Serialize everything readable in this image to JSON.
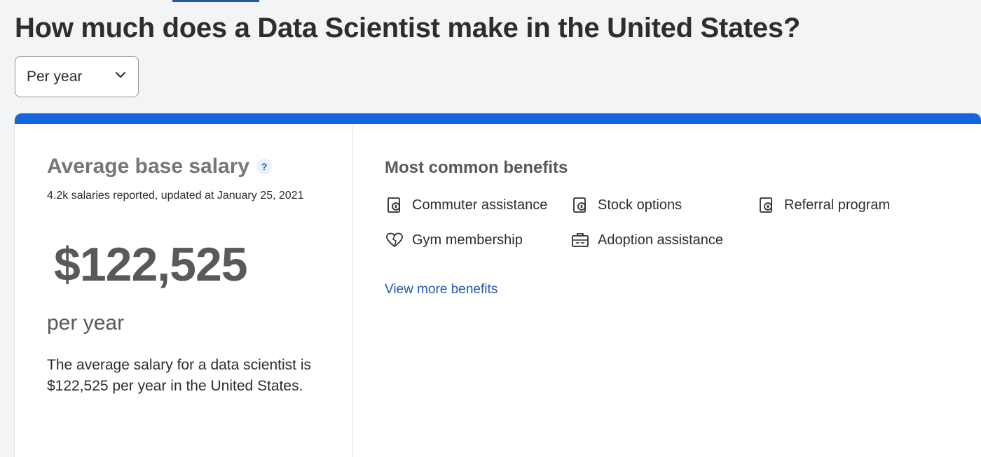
{
  "page": {
    "title": "How much does a Data Scientist make in the United States?"
  },
  "period_select": {
    "value": "Per year"
  },
  "salary": {
    "heading": "Average base salary",
    "help": "?",
    "meta": "4.2k salaries reported, updated at January 25, 2021",
    "amount": "$122,525",
    "period": "per year",
    "description": "The average salary for a data scientist is $122,525 per year in the United States."
  },
  "benefits": {
    "title": "Most common benefits",
    "items": [
      {
        "label": "Commuter assistance",
        "icon": "benefit-doc-icon"
      },
      {
        "label": "Stock options",
        "icon": "benefit-doc-icon"
      },
      {
        "label": "Referral program",
        "icon": "benefit-doc-icon"
      },
      {
        "label": "Gym membership",
        "icon": "heart-icon"
      },
      {
        "label": "Adoption assistance",
        "icon": "briefcase-icon"
      }
    ],
    "view_more": "View more benefits"
  },
  "colors": {
    "accent_bar": "#1665e0",
    "link": "#2557a7",
    "heading_gray": "#767676"
  }
}
